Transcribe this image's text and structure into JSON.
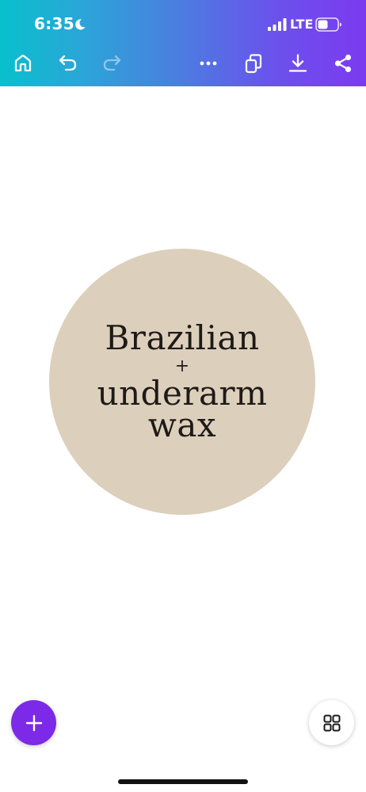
{
  "status_bar": {
    "time": "6:35",
    "network": "LTE"
  },
  "toolbar": {
    "icons": [
      "home-icon",
      "undo-icon",
      "redo-icon",
      "more-icon",
      "pages-icon",
      "download-icon",
      "share-icon"
    ]
  },
  "design": {
    "line1": "Brazilian",
    "line2": "+",
    "line3": "underarm",
    "line4": "wax",
    "circle_color": "#dccfbc"
  },
  "fab": {
    "add_label": "+"
  },
  "colors": {
    "accent": "#7d2ae8",
    "header_gradient_start": "#08c0cc",
    "header_gradient_end": "#7c3af0"
  }
}
